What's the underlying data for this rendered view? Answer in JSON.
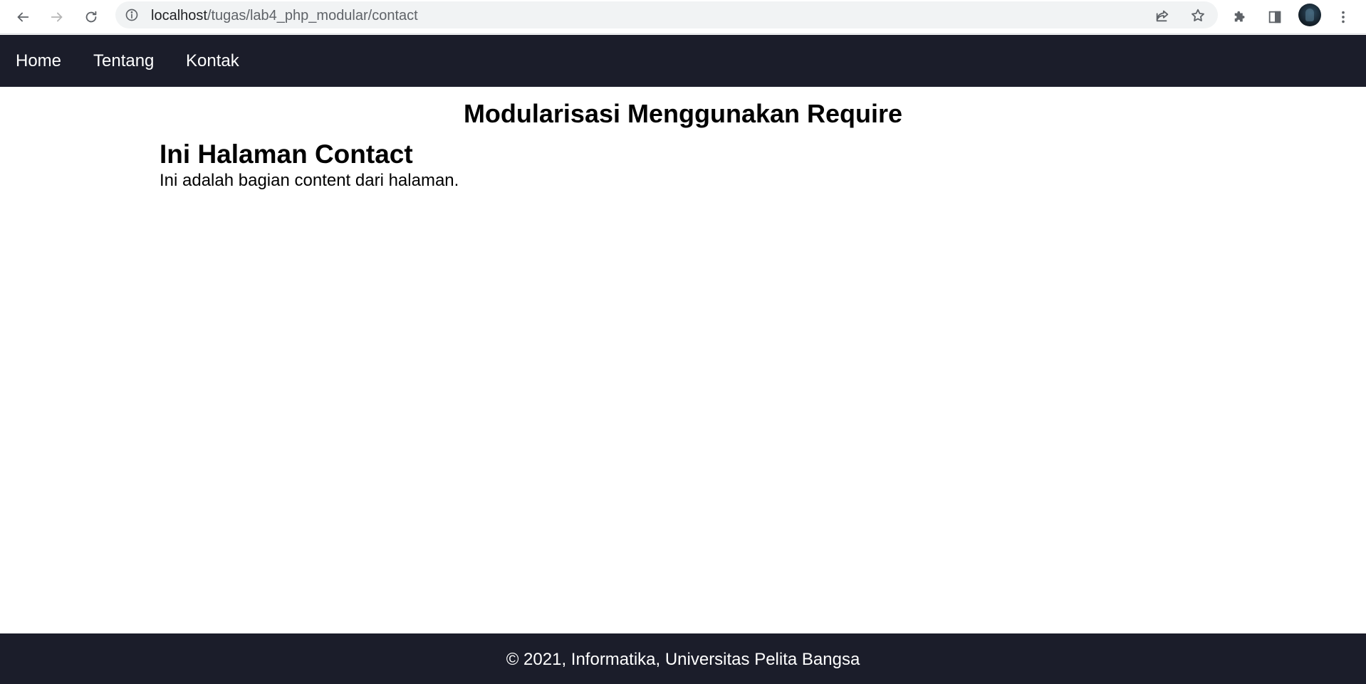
{
  "browser": {
    "url_host": "localhost",
    "url_path": "/tugas/lab4_php_modular/contact",
    "icons": [
      "back-icon",
      "forward-icon",
      "reload-icon",
      "info-icon",
      "share-icon",
      "star-icon",
      "extensions-icon",
      "side-panel-icon",
      "avatar",
      "more-icon"
    ]
  },
  "nav": {
    "items": [
      "Home",
      "Tentang",
      "Kontak"
    ]
  },
  "header": {
    "title": "Modularisasi Menggunakan Require"
  },
  "main": {
    "heading": "Ini Halaman Contact",
    "content": "Ini adalah bagian content dari halaman."
  },
  "footer": {
    "text": "© 2021, Informatika, Universitas Pelita Bangsa"
  },
  "colors": {
    "nav_bg": "#1b1d2a",
    "footer_bg": "#1b1d2a",
    "text": "#000000"
  }
}
